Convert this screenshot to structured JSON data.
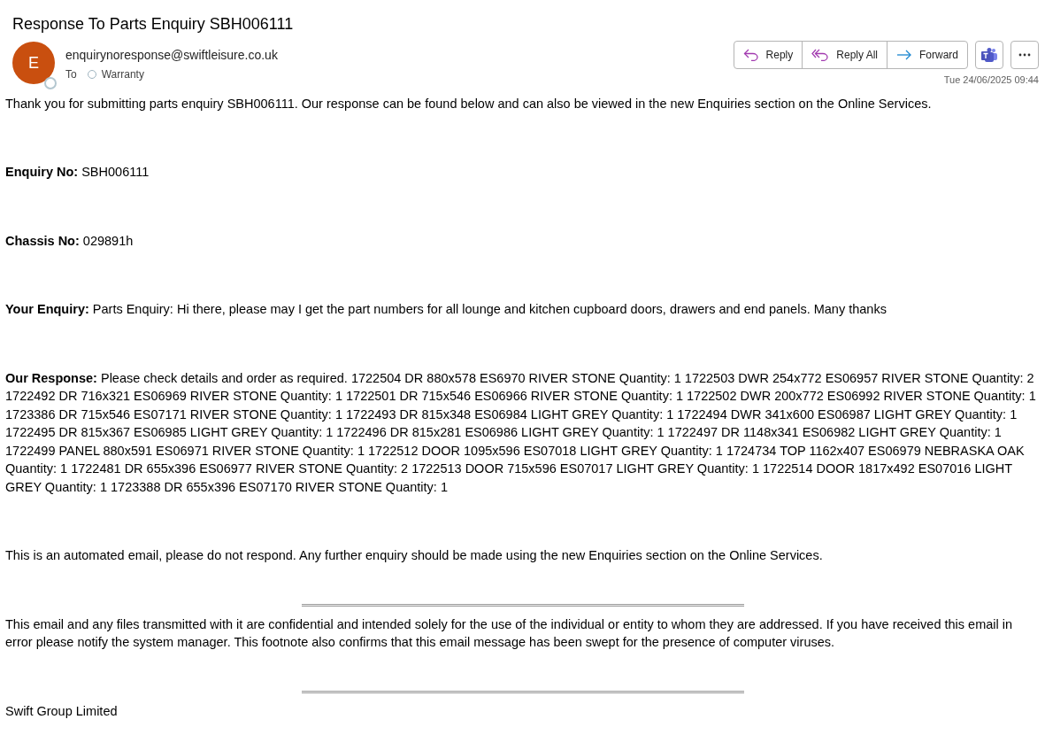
{
  "subject": "Response To Parts Enquiry SBH006111",
  "sender": {
    "initial": "E",
    "email": "enquirynoresponse@swiftleisure.co.uk",
    "to_label": "To",
    "recipient": "Warranty"
  },
  "actions": [
    {
      "kind": "reply",
      "label": "Reply"
    },
    {
      "kind": "reply_all",
      "label": "Reply All"
    },
    {
      "kind": "forward",
      "label": "Forward"
    }
  ],
  "date": "Tue 24/06/2025 09:44",
  "body": [
    {
      "kind": "para",
      "text": "Thank you for submitting parts enquiry SBH006111. Our response can be found below and can also be viewed in the new Enquiries section on the Online Services."
    },
    {
      "kind": "para",
      "text": "**Enquiry No:** SBH006111"
    },
    {
      "kind": "para",
      "text": "**Chassis No:** 029891h"
    },
    {
      "kind": "para",
      "text": "**Your Enquiry:** Parts Enquiry: Hi there, please may I get the part numbers for all lounge and kitchen cupboard doors, drawers and end panels. Many thanks"
    },
    {
      "kind": "para",
      "text": "**Our Response:** Please check details and order as required. 1722504 DR 880x578 ES6970 RIVER STONE Quantity: 1 1722503 DWR 254x772 ES06957 RIVER STONE Quantity: 2 1722492 DR 716x321 ES06969 RIVER STONE Quantity: 1 1722501 DR 715x546 ES06966 RIVER STONE Quantity: 1 1722502 DWR 200x772 ES06992 RIVER STONE Quantity: 1 1723386 DR 715x546 ES07171 RIVER STONE Quantity: 1 1722493 DR 815x348 ES06984 LIGHT GREY Quantity: 1 1722494 DWR 341x600 ES06987 LIGHT GREY Quantity: 1 1722495 DR 815x367 ES06985 LIGHT GREY Quantity: 1 1722496 DR 815x281 ES06986 LIGHT GREY Quantity: 1 1722497 DR 1148x341 ES06982 LIGHT GREY Quantity: 1 1722499 PANEL 880x591 ES06971 RIVER STONE Quantity: 1 1722512 DOOR 1095x596 ES07018 LIGHT GREY Quantity: 1 1724734 TOP 1162x407 ES06979 NEBRASKA OAK Quantity: 1 1722481 DR 655x396 ES06977 RIVER STONE Quantity: 2 1722513 DOOR 715x596 ES07017 LIGHT GREY Quantity: 1 1722514 DOOR 1817x492 ES07016 LIGHT GREY Quantity: 1 1723388 DR 655x396 ES07170 RIVER STONE Quantity: 1"
    },
    {
      "kind": "para",
      "text": "This is an automated email, please do not respond. Any further enquiry should be made using the new Enquiries section on the Online Services."
    },
    {
      "kind": "rule"
    },
    {
      "kind": "note",
      "text": "This email and any files transmitted with it are confidential and intended solely for the use of the individual or entity to whom they are addressed. If you have received this email in error please notify the system manager. This footnote also confirms that this email message has been swept for the presence of computer viruses."
    },
    {
      "kind": "rule"
    },
    {
      "kind": "note",
      "text": "Swift Group Limited"
    }
  ]
}
